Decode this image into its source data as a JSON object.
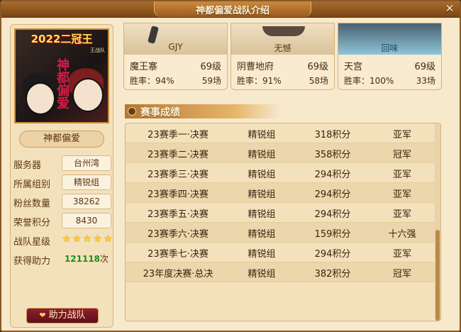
{
  "window": {
    "title": "神都偏爱战队介绍",
    "close_glyph": "✕"
  },
  "team": {
    "avatar_title": "2022二冠王",
    "avatar_badge": "王战队",
    "avatar_calligraphy": "神都偏爱",
    "name": "神都偏爱",
    "info": [
      {
        "label": "服务器",
        "value": "台州湾"
      },
      {
        "label": "所属组别",
        "value": "精锐组"
      },
      {
        "label": "粉丝数量",
        "value": "38262"
      },
      {
        "label": "荣誉积分",
        "value": "8430"
      }
    ],
    "stars_label": "战队星级",
    "stars": 5,
    "boost_label": "获得助力",
    "boost_value": "121118",
    "boost_unit": "次",
    "boost_button": "助力战队",
    "boost_icon": "heart-icon"
  },
  "opponents": [
    {
      "tag": "GJY",
      "name": "魔王寨",
      "level": "69级",
      "rate": "胜率：94%",
      "games": "59场"
    },
    {
      "tag": "无憾",
      "name": "阴曹地府",
      "level": "69级",
      "rate": "胜率：91%",
      "games": "58场"
    },
    {
      "tag": "回味",
      "name": "天宫",
      "level": "69级",
      "rate": "胜率：100%",
      "games": "33场"
    }
  ],
  "results": {
    "section_title": "赛事成绩",
    "section_icon": "trophy-icon",
    "rows": [
      {
        "event": "23赛季一·决赛",
        "group": "精锐组",
        "points": "318积分",
        "place": "亚军"
      },
      {
        "event": "23赛季二·决赛",
        "group": "精锐组",
        "points": "358积分",
        "place": "冠军"
      },
      {
        "event": "23赛季三·决赛",
        "group": "精锐组",
        "points": "294积分",
        "place": "亚军"
      },
      {
        "event": "23赛季四·决赛",
        "group": "精锐组",
        "points": "294积分",
        "place": "亚军"
      },
      {
        "event": "23赛季五·决赛",
        "group": "精锐组",
        "points": "294积分",
        "place": "亚军"
      },
      {
        "event": "23赛季六·决赛",
        "group": "精锐组",
        "points": "159积分",
        "place": "十六强"
      },
      {
        "event": "23赛季七·决赛",
        "group": "精锐组",
        "points": "294积分",
        "place": "亚军"
      },
      {
        "event": "23年度决赛·总决",
        "group": "精锐组",
        "points": "382积分",
        "place": "冠军"
      }
    ]
  }
}
